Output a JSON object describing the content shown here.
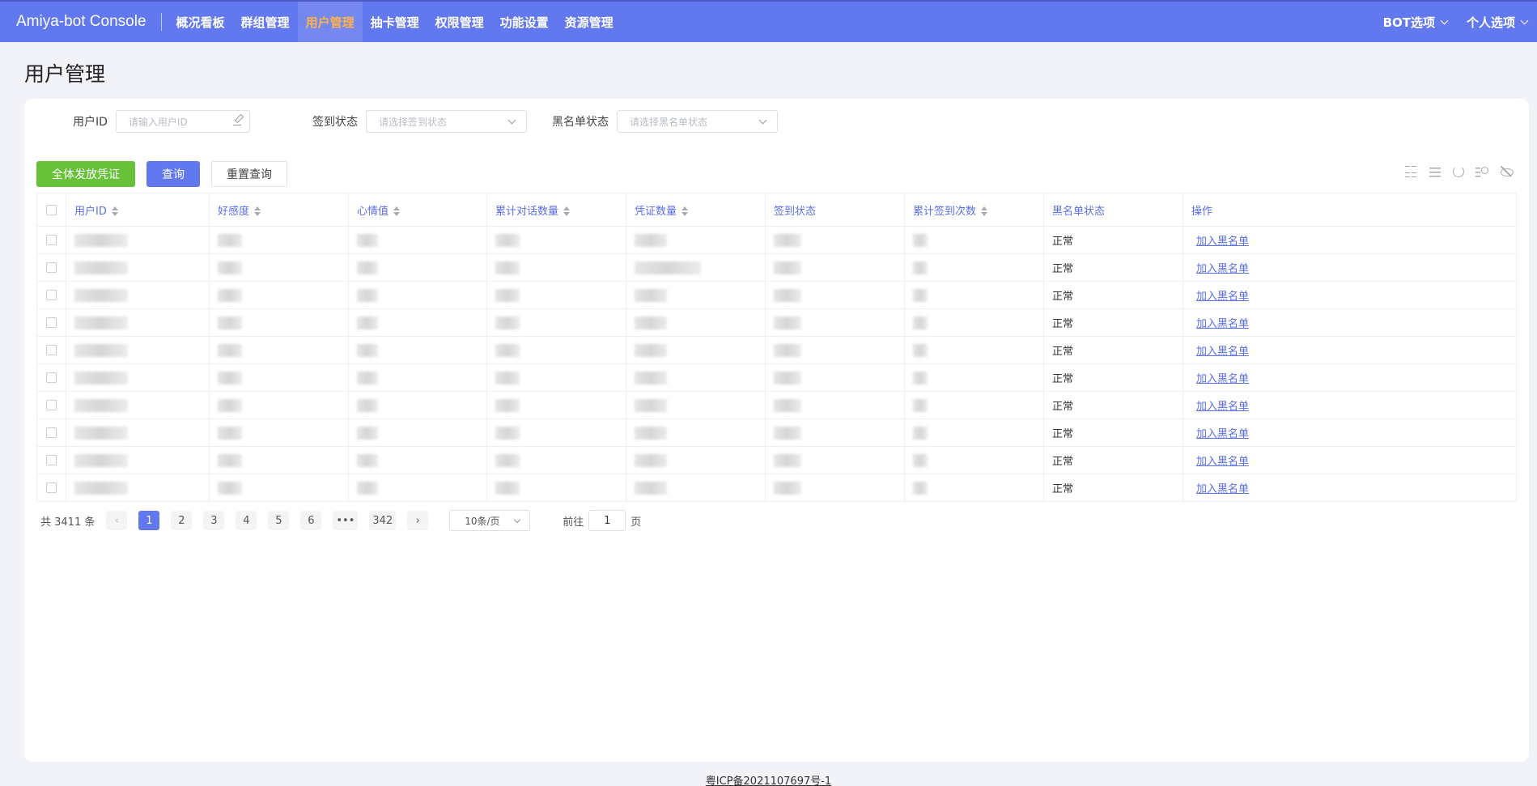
{
  "brand": "Amiya-bot Console",
  "nav": [
    "概况看板",
    "群组管理",
    "用户管理",
    "抽卡管理",
    "权限管理",
    "功能设置",
    "资源管理"
  ],
  "nav_right": [
    "BOT选项",
    "个人选项"
  ],
  "page_title": "用户管理",
  "filters": {
    "user_id": {
      "label": "用户ID",
      "placeholder": "请输入用户ID"
    },
    "sign": {
      "label": "签到状态",
      "placeholder": "请选择签到状态"
    },
    "blacklist": {
      "label": "黑名单状态",
      "placeholder": "请选择黑名单状态"
    }
  },
  "buttons": {
    "grant_all": "全体发放凭证",
    "query": "查询",
    "reset": "重置查询"
  },
  "columns": [
    "用户ID",
    "好感度",
    "心情值",
    "累计对话数量",
    "凭证数量",
    "签到状态",
    "累计签到次数",
    "黑名单状态",
    "操作"
  ],
  "rows": [
    {
      "status": "正常",
      "action": "加入黑名单"
    },
    {
      "status": "正常",
      "action": "加入黑名单"
    },
    {
      "status": "正常",
      "action": "加入黑名单"
    },
    {
      "status": "正常",
      "action": "加入黑名单"
    },
    {
      "status": "正常",
      "action": "加入黑名单"
    },
    {
      "status": "正常",
      "action": "加入黑名单"
    },
    {
      "status": "正常",
      "action": "加入黑名单"
    },
    {
      "status": "正常",
      "action": "加入黑名单"
    },
    {
      "status": "正常",
      "action": "加入黑名单"
    },
    {
      "status": "正常",
      "action": "加入黑名单"
    }
  ],
  "pagination": {
    "total": "共 3411 条",
    "pages": [
      "1",
      "2",
      "3",
      "4",
      "5",
      "6",
      "•••",
      "342"
    ],
    "current": "1",
    "page_size": "10条/页",
    "goto_label": "前往",
    "goto_value": "1",
    "goto_suffix": "页"
  },
  "footer": "粤ICP备2021107697号-1",
  "colors": {
    "primary": "#6278ee",
    "success": "#67c23a",
    "active_nav_text": "#ffb34c"
  }
}
